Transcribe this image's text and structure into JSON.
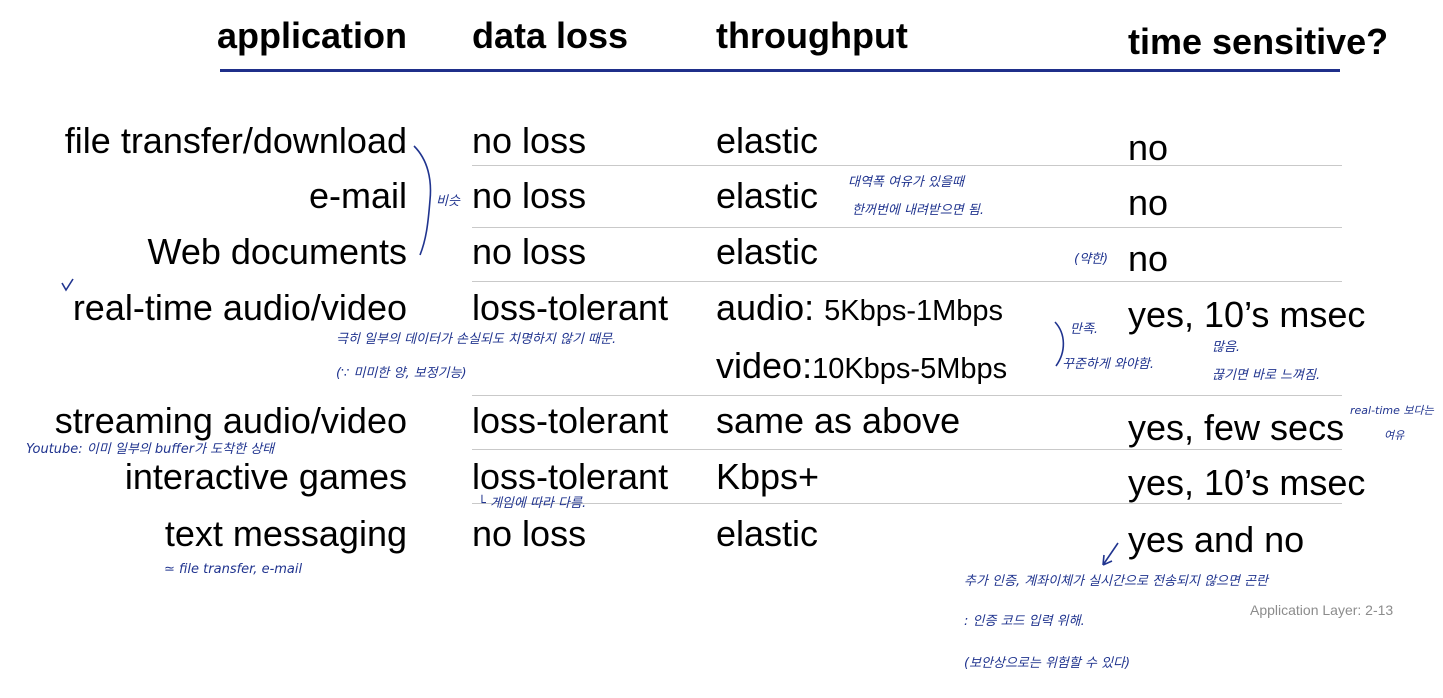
{
  "headers": {
    "application": "application",
    "data_loss": "data loss",
    "throughput": "throughput",
    "time_sensitive": "time sensitive?"
  },
  "rows": [
    {
      "app": "file transfer/download",
      "loss": "no loss",
      "throughput": "elastic",
      "time": "no"
    },
    {
      "app": "e-mail",
      "loss": "no loss",
      "throughput": "elastic",
      "time": "no"
    },
    {
      "app": "Web documents",
      "loss": "no loss",
      "throughput": "elastic",
      "time": "no"
    },
    {
      "app": "real-time audio/video",
      "loss": "loss-tolerant",
      "throughput_audio_prefix": "audio: ",
      "throughput_audio_rate": "5Kbps-1Mbps",
      "throughput_video_prefix": "video:",
      "throughput_video_rate": "10Kbps-5Mbps",
      "time": "yes, 10’s msec"
    },
    {
      "app": "streaming audio/video",
      "loss": "loss-tolerant",
      "throughput": "same as above",
      "time": "yes, few secs"
    },
    {
      "app": "interactive games",
      "loss": "loss-tolerant",
      "throughput": "Kbps+",
      "time": "yes, 10’s msec"
    },
    {
      "app": "text messaging",
      "loss": "no loss",
      "throughput": "elastic",
      "time": "yes and no"
    }
  ],
  "annotations": {
    "similar": "비슷",
    "elastic_note_1": "대역폭 여유가 있을때",
    "elastic_note_2": "한꺼번에 내려받으면 됨.",
    "weak": "(약한)",
    "realtime_note_1": "극히 일부의 데이터가 손실되도 치명하지 않기 때문.",
    "realtime_note_2": "(∵ 미미한 양, 보정기능)",
    "guarantee_1": "만족.",
    "guarantee_2": "꾸준하게 와야함.",
    "many_1": "많음.",
    "many_2": "끊기면 바로 느껴짐.",
    "streaming_side_1": "real-time 보다는",
    "streaming_side_2": "여유",
    "youtube": "Youtube: 이미 일부의 buffer가 도착한 상태",
    "games_note": "└ 게임에 따라 다름.",
    "text_eq": "≃ file transfer, e-mail",
    "yes_no_1": "추가 인증, 계좌이체가 실시간으로 전송되지 않으면 곤란",
    "yes_no_2": ": 인증 코드 입력 위해.",
    "yes_no_3": "(보안상으로는 위험할 수 있다)"
  },
  "footer": "Application Layer: 2-13"
}
